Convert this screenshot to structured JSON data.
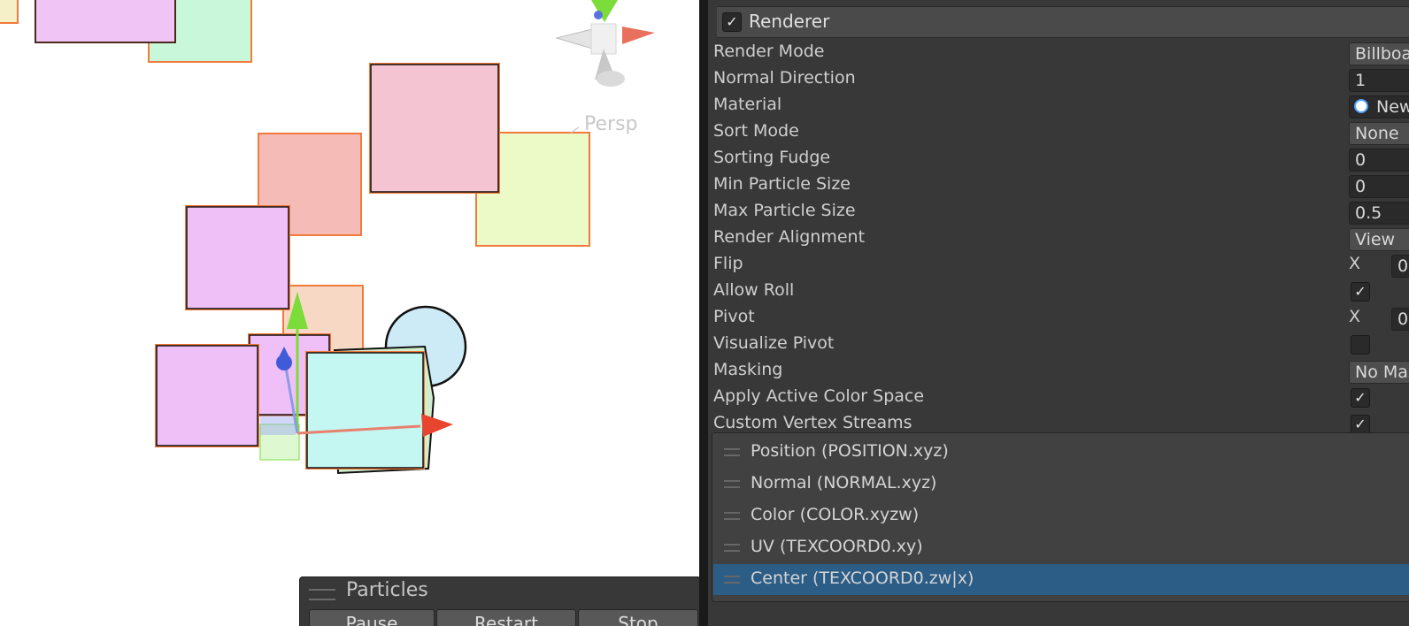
{
  "scene": {
    "view_label": "Persp",
    "particles_overlay": {
      "title": "Particles",
      "buttons": [
        "Pause",
        "Restart",
        "Stop"
      ]
    }
  },
  "inspector": {
    "module": {
      "title": "Renderer",
      "enabled": "✓"
    },
    "properties": {
      "render_mode": {
        "label": "Render Mode",
        "value": "Billboard"
      },
      "normal_direction": {
        "label": "Normal Direction",
        "value": "1"
      },
      "material": {
        "label": "Material",
        "value": "New"
      },
      "sort_mode": {
        "label": "Sort Mode",
        "value": "None"
      },
      "sorting_fudge": {
        "label": "Sorting Fudge",
        "value": "0"
      },
      "min_particle_size": {
        "label": "Min Particle Size",
        "value": "0"
      },
      "max_particle_size": {
        "label": "Max Particle Size",
        "value": "0.5"
      },
      "render_alignment": {
        "label": "Render Alignment",
        "value": "View"
      },
      "flip": {
        "label": "Flip",
        "axis": "X",
        "value": "0"
      },
      "allow_roll": {
        "label": "Allow Roll",
        "checked": "✓"
      },
      "pivot": {
        "label": "Pivot",
        "axis": "X",
        "value": "0"
      },
      "visualize_pivot": {
        "label": "Visualize Pivot",
        "checked": ""
      },
      "masking": {
        "label": "Masking",
        "value": "No Masking"
      },
      "apply_active_color_space": {
        "label": "Apply Active Color Space",
        "checked": "✓"
      },
      "custom_vertex_streams": {
        "label": "Custom Vertex Streams",
        "checked": "✓"
      }
    },
    "vertex_streams": [
      "Position (POSITION.xyz)",
      "Normal (NORMAL.xyz)",
      "Color (COLOR.xyzw)",
      "UV (TEXCOORD0.xy)",
      "Center (TEXCOORD0.zw|x)"
    ],
    "selected_stream_index": 4
  },
  "colors": {
    "selection": "#2c5d87",
    "panel": "#383838",
    "gizmo_x": "#e8442e",
    "gizmo_y": "#7bdc3a",
    "gizmo_z": "#3f5bd8",
    "particle_outline": "#f27a3c"
  }
}
